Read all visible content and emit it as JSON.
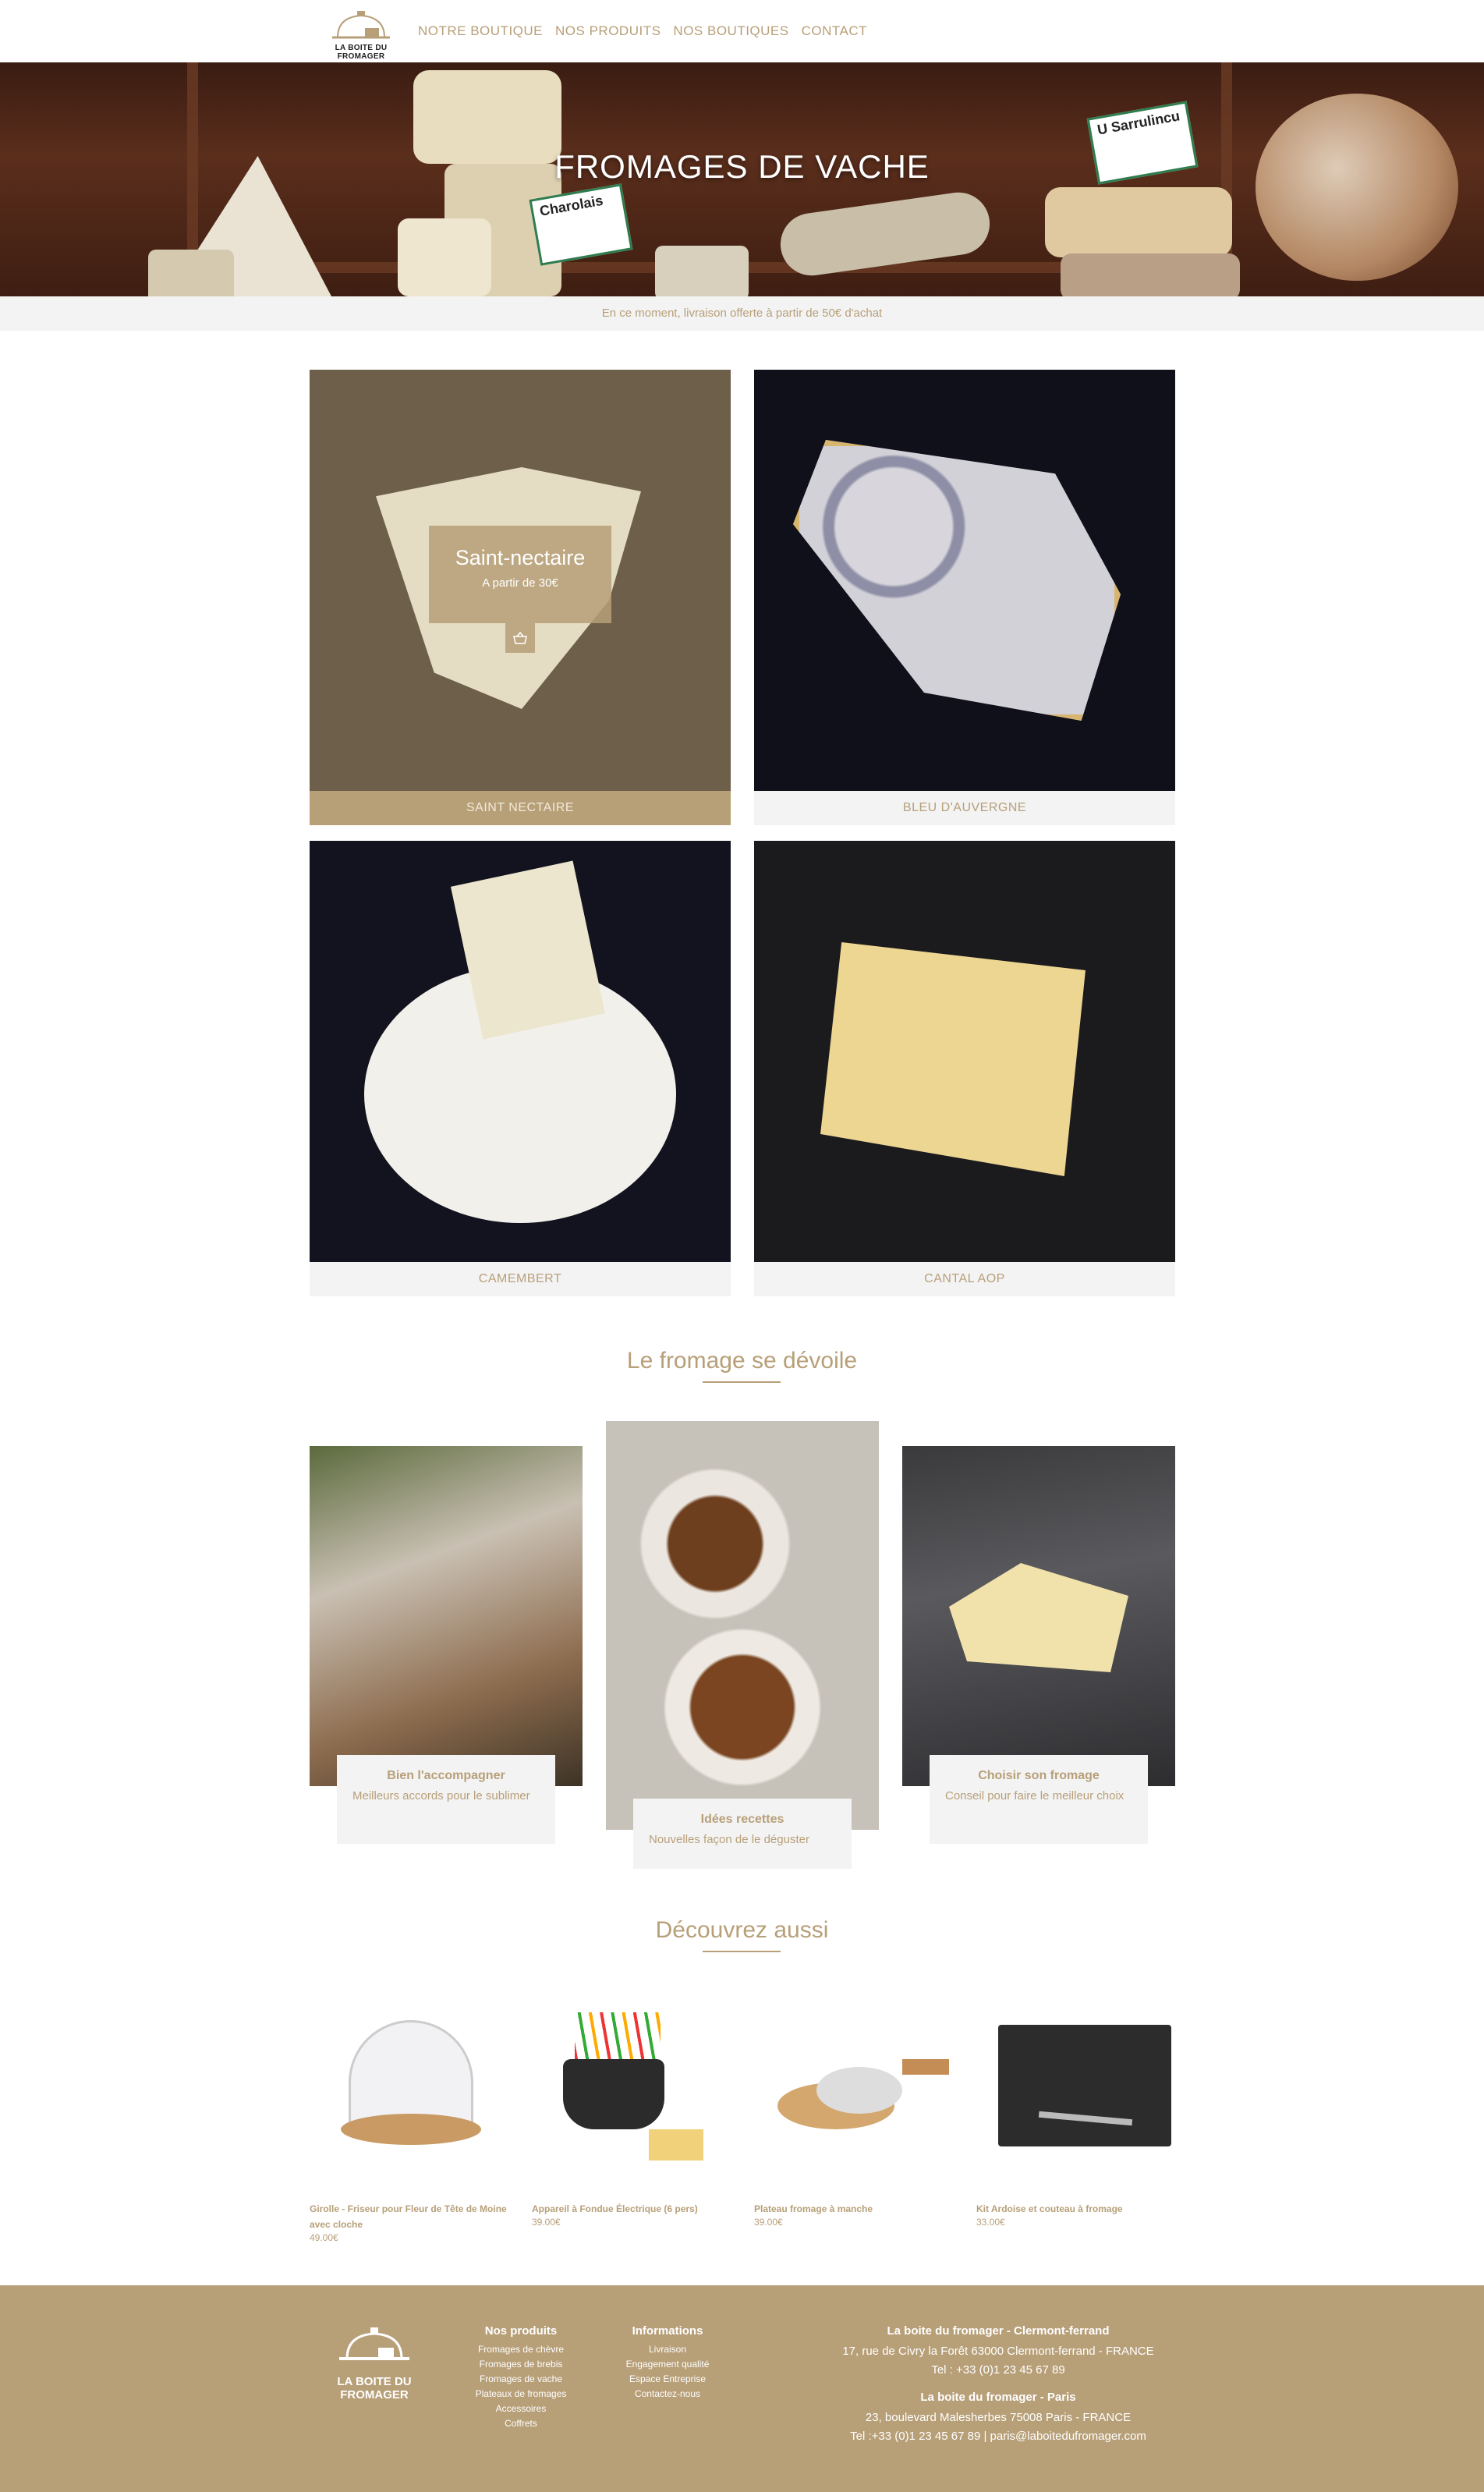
{
  "header": {
    "logo_text": "LA BOITE DU FROMAGER",
    "nav": [
      "NOTRE BOUTIQUE",
      "NOS PRODUITS",
      "NOS BOUTIQUES",
      "CONTACT"
    ]
  },
  "hero": {
    "title": "FROMAGES DE VACHE",
    "tags": [
      "Charolais",
      "U Sarrulincu"
    ]
  },
  "notice": "En ce moment, livraison offerte à partir de 50€ d'achat",
  "products": [
    {
      "label": "SAINT NECTAIRE",
      "overlay_name": "Saint-nectaire",
      "overlay_price": "A partir de 30€"
    },
    {
      "label": "BLEU D'AUVERGNE"
    },
    {
      "label": "CAMEMBERT"
    },
    {
      "label": "CANTAL AOP"
    }
  ],
  "section1": {
    "title": "Le fromage se dévoile",
    "cards": [
      {
        "title": "Bien l'accompagner",
        "desc": "Meilleurs accords pour le sublimer"
      },
      {
        "title": "Idées recettes",
        "desc": "Nouvelles façon de le déguster"
      },
      {
        "title": "Choisir son fromage",
        "desc": "Conseil pour faire le meilleur choix"
      }
    ]
  },
  "section2": {
    "title": "Découvrez aussi",
    "items": [
      {
        "name": "Girolle - Friseur pour Fleur de Tête de Moine avec cloche",
        "price": "49.00€"
      },
      {
        "name": "Appareil à Fondue Électrique (6 pers)",
        "price": "39.00€"
      },
      {
        "name": "Plateau fromage à manche",
        "price": "39.00€"
      },
      {
        "name": "Kit Ardoise et couteau à fromage",
        "price": "33.00€"
      }
    ]
  },
  "footer": {
    "logo_text": "LA BOITE DU FROMAGER",
    "products_title": "Nos produits",
    "products_links": [
      "Fromages de chèvre",
      "Fromages de brebis",
      "Fromages de vache",
      "Plateaux de fromages",
      "Accessoires",
      "Coffrets"
    ],
    "info_title": "Informations",
    "info_links": [
      "Livraison",
      "Engagement qualité",
      "Espace Entreprise",
      "Contactez-nous"
    ],
    "shop1_title": "La boite du fromager - Clermont-ferrand",
    "shop1_addr": "17, rue de Civry la Forêt 63000 Clermont-ferrand - FRANCE",
    "shop1_tel": "Tel : +33 (0)1 23 45 67 89",
    "shop2_title": "La boite du fromager - Paris",
    "shop2_addr": "23, boulevard Malesherbes 75008 Paris - FRANCE",
    "shop2_tel": "Tel :+33 (0)1 23 45 67 89 | paris@laboitedufromager.com"
  },
  "colors": {
    "accent": "#b79f78",
    "light_bg": "#f3f3f3",
    "white": "#ffffff"
  }
}
